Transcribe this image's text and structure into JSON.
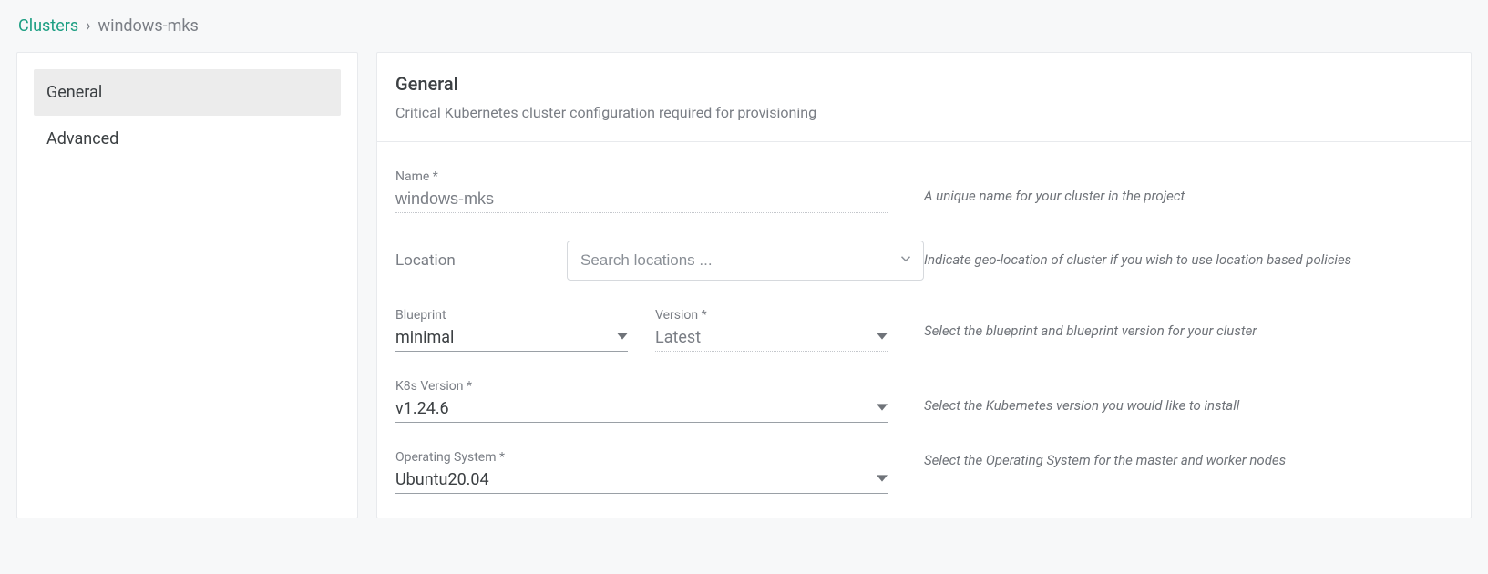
{
  "breadcrumb": {
    "root": "Clusters",
    "separator": "›",
    "current": "windows-mks"
  },
  "sidebar": {
    "items": [
      {
        "label": "General",
        "active": true
      },
      {
        "label": "Advanced",
        "active": false
      }
    ]
  },
  "panel": {
    "title": "General",
    "subtitle": "Critical Kubernetes cluster configuration required for provisioning"
  },
  "fields": {
    "name": {
      "label": "Name *",
      "value": "windows-mks",
      "help": "A unique name for your cluster in the project"
    },
    "location": {
      "label": "Location",
      "placeholder": "Search locations ...",
      "help": "Indicate geo-location of cluster if you wish to use location based policies"
    },
    "blueprint": {
      "label": "Blueprint",
      "value": "minimal"
    },
    "version": {
      "label": "Version *",
      "value": "Latest"
    },
    "blueprint_help": "Select the blueprint and blueprint version for your cluster",
    "k8s": {
      "label": "K8s Version *",
      "value": "v1.24.6",
      "help": "Select the Kubernetes version you would like to install"
    },
    "os": {
      "label": "Operating System *",
      "value": "Ubuntu20.04",
      "help": "Select the Operating System for the master and worker nodes"
    }
  }
}
